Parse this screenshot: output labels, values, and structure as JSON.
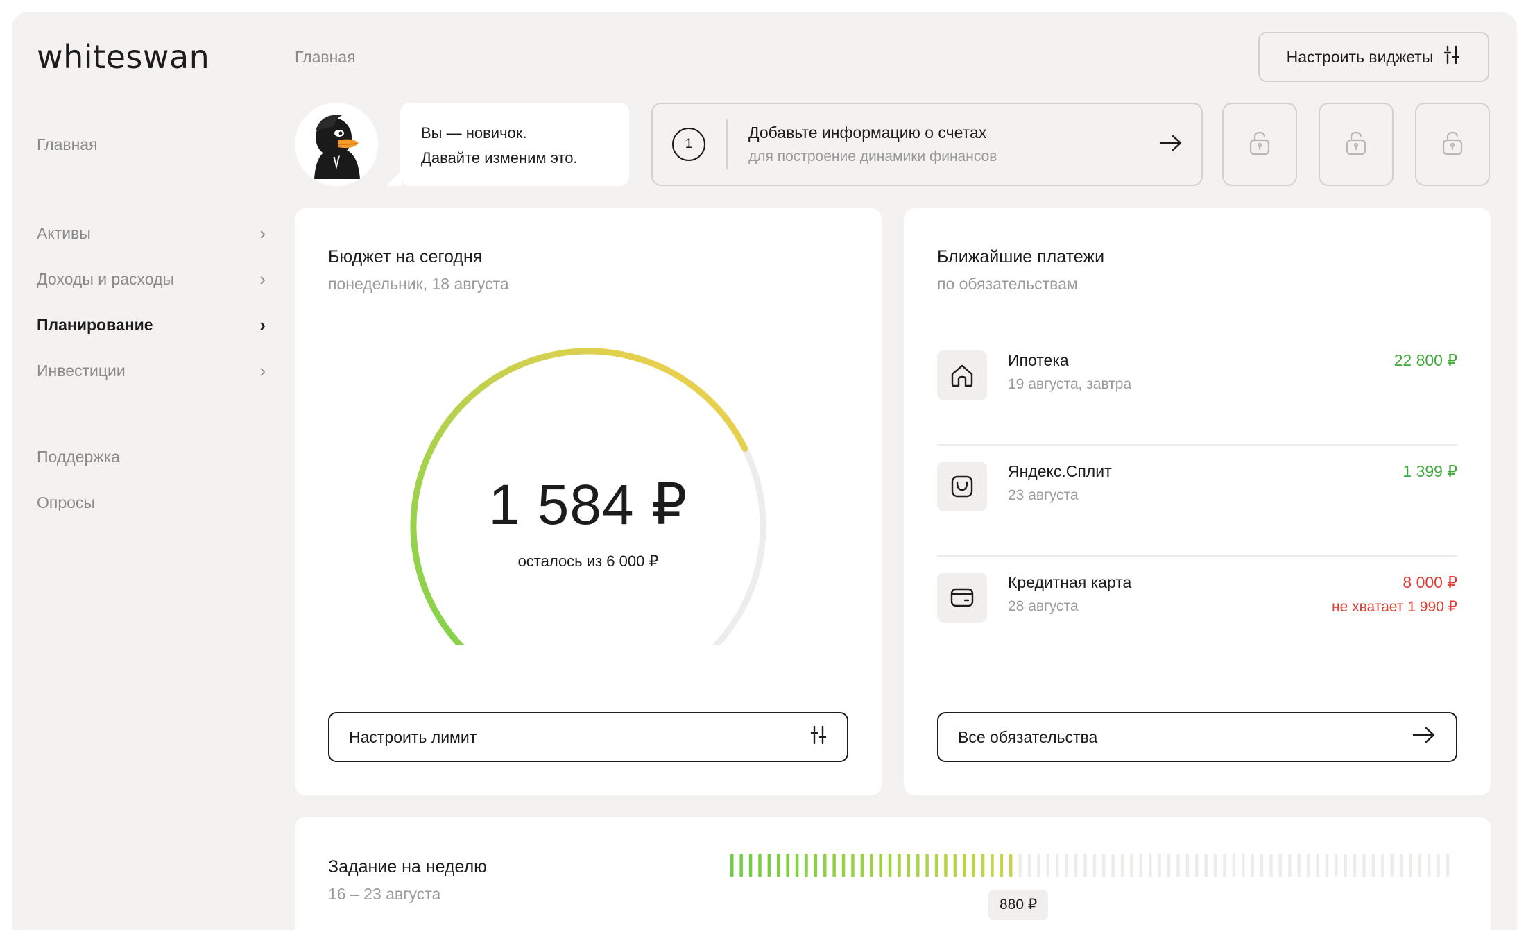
{
  "app": {
    "logo": "whiteswan"
  },
  "sidebar": {
    "home": "Главная",
    "items": [
      {
        "label": "Активы",
        "active": false
      },
      {
        "label": "Доходы и расходы",
        "active": false
      },
      {
        "label": "Планирование",
        "active": true
      },
      {
        "label": "Инвестиции",
        "active": false
      }
    ],
    "support": "Поддержка",
    "surveys": "Опросы"
  },
  "header": {
    "breadcrumb": "Главная",
    "config_label": "Настроить виджеты"
  },
  "onboarding": {
    "bubble_line1": "Вы — новичок.",
    "bubble_line2": "Давайте изменим это.",
    "step_number": "1",
    "step_title": "Добавьте информацию о счетах",
    "step_sub": "для построение динамики финансов",
    "locked_tiles": 3
  },
  "budget": {
    "title": "Бюджет на сегодня",
    "date": "понедельник, 18 августа",
    "remaining": "1 584 ₽",
    "caption": "осталось из 6 000 ₽",
    "fraction_used": 0.736,
    "button_label": "Настроить лимит"
  },
  "payments": {
    "title": "Ближайшие платежи",
    "subtitle": "по обязательствам",
    "items": [
      {
        "icon": "house-icon",
        "name": "Ипотека",
        "date": "19 августа, завтра",
        "amount": "22 800 ₽",
        "status": "ok",
        "warning": ""
      },
      {
        "icon": "bag-icon",
        "name": "Яндекс.Сплит",
        "date": "23 августа",
        "amount": "1 399 ₽",
        "status": "ok",
        "warning": ""
      },
      {
        "icon": "wallet-icon",
        "name": "Кредитная карта",
        "date": "28 августа",
        "amount": "8 000 ₽",
        "status": "warn",
        "warning": "не хватает 1 990 ₽"
      }
    ],
    "button_label": "Все обязательства"
  },
  "weekly_task": {
    "title": "Задание на неделю",
    "range": "16 – 23 августа",
    "progress_fraction": 0.4,
    "badge": "880 ₽"
  },
  "colors": {
    "accent_green": "#3fa83a",
    "warn_red": "#e03b35",
    "gauge_start": "#7fd24a",
    "gauge_end": "#f9d04f",
    "track": "#ededec"
  }
}
